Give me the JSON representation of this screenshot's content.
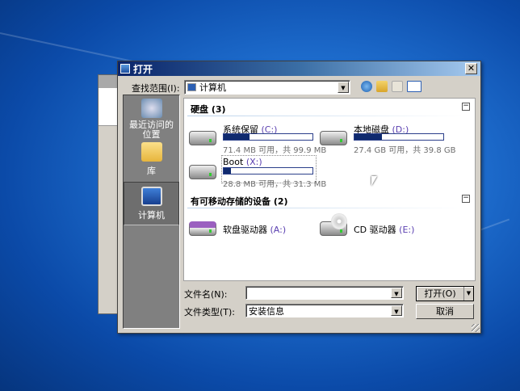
{
  "background_window": {
    "title": "打开"
  },
  "dialog": {
    "title": "打开",
    "look_in_label": "查找范围(I):",
    "look_in_value": "计算机",
    "toolbar": {
      "back": "back-icon",
      "up": "up-folder-icon",
      "new_folder": "new-folder-icon",
      "views": "view-menu-icon"
    },
    "sidebar": [
      {
        "label": "最近访问的位置",
        "icon": "recent-places-icon"
      },
      {
        "label": "库",
        "icon": "libraries-icon"
      },
      {
        "label": "计算机",
        "icon": "computer-icon",
        "selected": true
      }
    ],
    "groups": [
      {
        "title": "硬盘 (3)",
        "drives": [
          {
            "name": "系统保留",
            "letter": "(C:)",
            "size": "71.4 MB 可用，共 99.9 MB",
            "used_fraction": 0.29
          },
          {
            "name": "本地磁盘",
            "letter": "(D:)",
            "size": "27.4 GB 可用，共 39.8 GB",
            "used_fraction": 0.31
          },
          {
            "name": "Boot",
            "letter": "(X:)",
            "size": "28.8 MB 可用，共 31.3 MB",
            "used_fraction": 0.08
          }
        ]
      },
      {
        "title": "有可移动存储的设备 (2)",
        "drives": [
          {
            "name": "软盘驱动器",
            "letter": "(A:)"
          },
          {
            "name": "CD 驱动器",
            "letter": "(E:)"
          }
        ]
      }
    ],
    "filename_label": "文件名(N):",
    "filename_value": "",
    "filetype_label": "文件类型(T):",
    "filetype_value": "安装信息",
    "open_button": "打开(O)",
    "cancel_button": "取消"
  }
}
